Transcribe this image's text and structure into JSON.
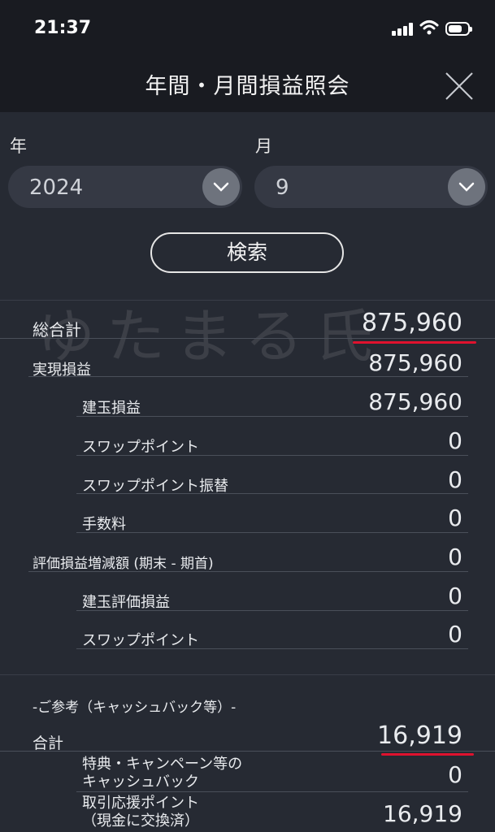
{
  "status_bar": {
    "time": "21:37"
  },
  "header": {
    "title": "年間・月間損益照会",
    "close_icon": "close-icon"
  },
  "filters": {
    "year_label": "年",
    "year_value": "2024",
    "month_label": "月",
    "month_value": "9",
    "search_label": "検索"
  },
  "watermark": "ゆたまる氏",
  "summary": {
    "total_label": "総合計",
    "total_value": "875,960",
    "realized_label": "実現損益",
    "realized_value": "875,960",
    "position_pl_label": "建玉損益",
    "position_pl_value": "875,960",
    "swap_label": "スワップポイント",
    "swap_value": "0",
    "swap_transfer_label": "スワップポイント振替",
    "swap_transfer_value": "0",
    "fee_label": "手数料",
    "fee_value": "0",
    "valuation_change_label": "評価損益増減額 (期末 - 期首)",
    "valuation_change_value": "0",
    "position_valuation_label": "建玉評価損益",
    "position_valuation_value": "0",
    "swap2_label": "スワップポイント",
    "swap2_value": "0"
  },
  "reference": {
    "heading": "-ご参考（キャッシュバック等）-",
    "total_label": "合計",
    "total_value": "16,919",
    "campaign_line1": "特典・キャンペーン等の",
    "campaign_line2": "キャッシュバック",
    "campaign_value": "0",
    "points_line1": "取引応援ポイント",
    "points_line2": "（現金に交換済）",
    "points_value": "16,919"
  },
  "colors": {
    "background": "#262a33",
    "header": "#191b21",
    "highlight_underline": "#e0122e"
  }
}
